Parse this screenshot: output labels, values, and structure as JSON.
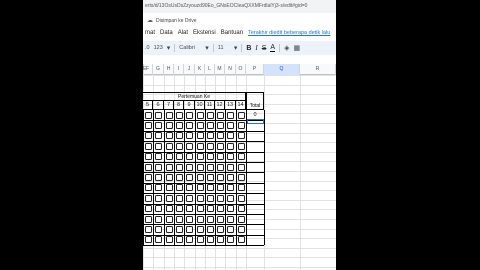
{
  "browser": {
    "url": "erts/d/13OsUsDsZzyouzd90Eo_GNsEOCIeaQXXMFrdlalYj3-s/edit#gid=0"
  },
  "doc_status": {
    "save_text": "Disimpan ke Drive",
    "icon": "cloud-done-icon"
  },
  "menu": {
    "items": [
      "mat",
      "Data",
      "Alat",
      "Ekstensi",
      "Bantuan"
    ],
    "last_edit": "Terakhir diedit beberapa detik lalu"
  },
  "toolbar": {
    "zoom": "123",
    "percent": ".0",
    "font": "Calibri",
    "font_size": "11",
    "bold": "B",
    "italic": "I",
    "strike": "S",
    "text_color": "A"
  },
  "columns": [
    "E",
    "F",
    "G",
    "H",
    "I",
    "J",
    "K",
    "L",
    "M",
    "N",
    "O",
    "P",
    "Q",
    "R",
    "S"
  ],
  "table": {
    "title": "Pertemuan Ke",
    "numbers": [
      "5",
      "6",
      "7",
      "8",
      "9",
      "10",
      "11",
      "12",
      "13",
      "14"
    ],
    "total_label": "Total",
    "total_first": "0",
    "rows": 13
  },
  "colors": {
    "selected_column": "#d3e3fd",
    "selection_border": "#1a73e8",
    "toolbar_bg": "#edf2fa"
  }
}
